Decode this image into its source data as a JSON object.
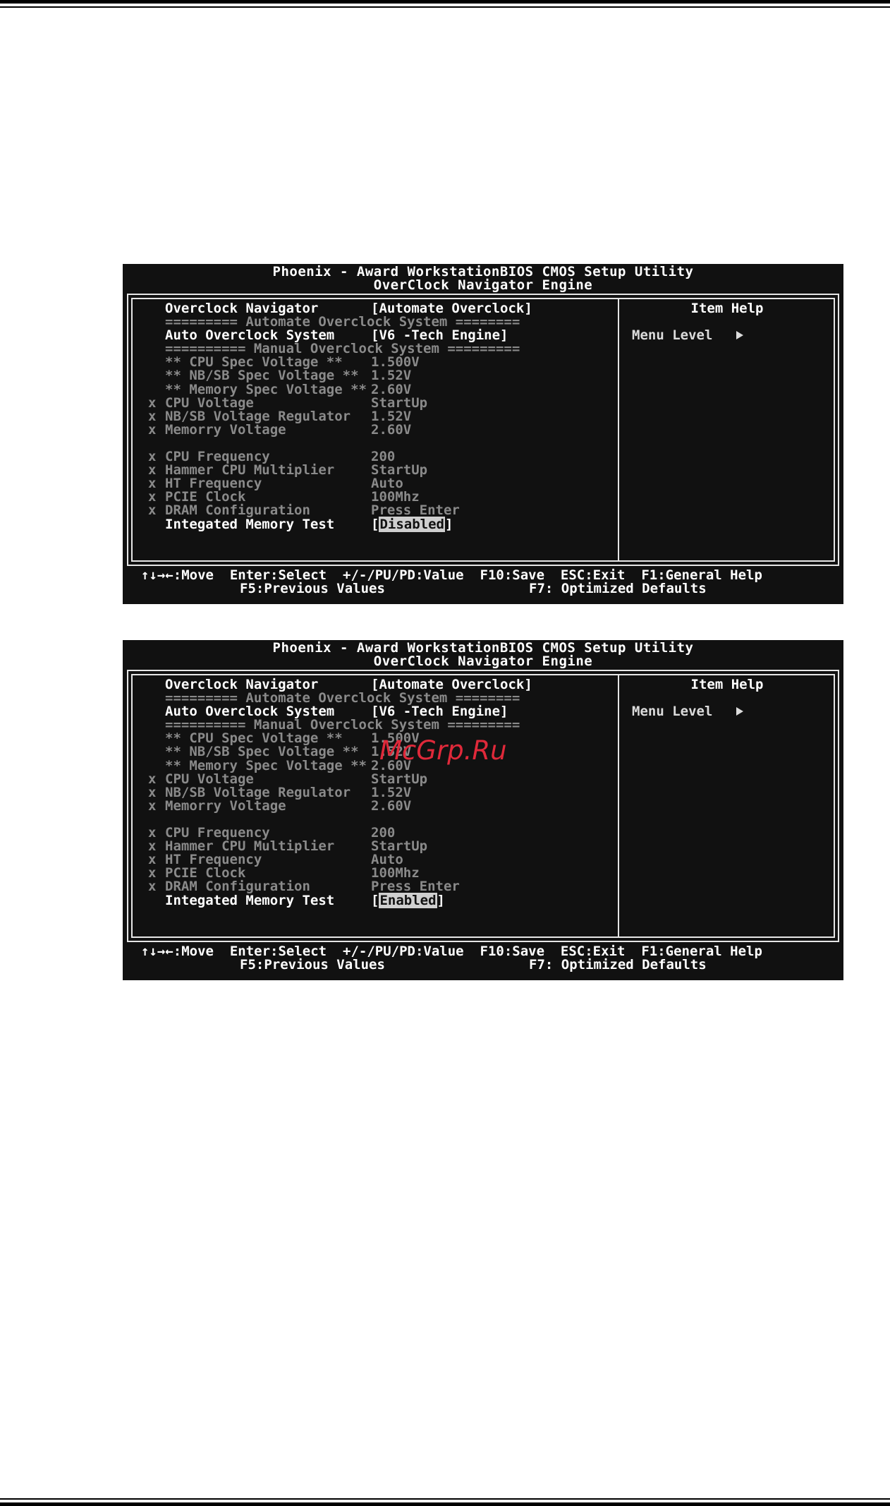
{
  "screens": [
    {
      "header": {
        "line1": "Phoenix - Award WorkstationBIOS CMOS Setup Utility",
        "line2": "OverClock Navigator Engine"
      },
      "rows": [
        {
          "mark": "",
          "label": "Overclock Navigator",
          "value": "[Automate Overclock]",
          "state": "active"
        },
        {
          "mark": "",
          "label": "========= Automate Overclock System ========",
          "value": "",
          "state": "separator"
        },
        {
          "mark": "",
          "label": "Auto Overclock System",
          "value": "[V6 -Tech Engine]",
          "state": "active"
        },
        {
          "mark": "",
          "label": "========== Manual Overclock System =========",
          "value": "",
          "state": "separator"
        },
        {
          "mark": "",
          "label": "** CPU Spec Voltage **",
          "value": "1.500V",
          "state": "disabled"
        },
        {
          "mark": "",
          "label": "** NB/SB Spec Voltage **",
          "value": "1.52V",
          "state": "disabled"
        },
        {
          "mark": "",
          "label": "** Memory Spec Voltage **",
          "value": "2.60V",
          "state": "disabled"
        },
        {
          "mark": "x",
          "label": "CPU Voltage",
          "value": "StartUp",
          "state": "disabled"
        },
        {
          "mark": "x",
          "label": "NB/SB Voltage Regulator",
          "value": "1.52V",
          "state": "disabled"
        },
        {
          "mark": "x",
          "label": "Memorry Voltage",
          "value": "2.60V",
          "state": "disabled"
        },
        {
          "mark": "",
          "label": "",
          "value": "",
          "state": "blank"
        },
        {
          "mark": "x",
          "label": "CPU Frequency",
          "value": "200",
          "state": "disabled"
        },
        {
          "mark": "x",
          "label": "Hammer CPU Multiplier",
          "value": "StartUp",
          "state": "disabled"
        },
        {
          "mark": "x",
          "label": "HT Frequency",
          "value": "Auto",
          "state": "disabled"
        },
        {
          "mark": "x",
          "label": "PCIE Clock",
          "value": "100Mhz",
          "state": "disabled"
        },
        {
          "mark": "x",
          "label": "DRAM Configuration",
          "value": "Press Enter",
          "state": "disabled"
        },
        {
          "mark": "",
          "label": "Integated Memory Test",
          "value": "[Disabled]",
          "state": "selected"
        }
      ],
      "help": {
        "title": "Item Help",
        "menu_level": "Menu Level"
      },
      "footer": {
        "move": "↑↓→←:Move",
        "select": "Enter:Select",
        "value": "+/-/PU/PD:Value",
        "save": "F10:Save",
        "exit": "ESC:Exit",
        "help": "F1:General Help",
        "previous": "F5:Previous Values",
        "defaults": "F7: Optimized Defaults"
      }
    },
    {
      "header": {
        "line1": "Phoenix - Award WorkstationBIOS CMOS Setup Utility",
        "line2": "OverClock Navigator Engine"
      },
      "rows": [
        {
          "mark": "",
          "label": "Overclock Navigator",
          "value": "[Automate Overclock]",
          "state": "active"
        },
        {
          "mark": "",
          "label": "========= Automate Overclock System ========",
          "value": "",
          "state": "separator"
        },
        {
          "mark": "",
          "label": "Auto Overclock System",
          "value": "[V6 -Tech Engine]",
          "state": "active"
        },
        {
          "mark": "",
          "label": "========== Manual Overclock System =========",
          "value": "",
          "state": "separator"
        },
        {
          "mark": "",
          "label": "** CPU Spec Voltage **",
          "value": "1.500V",
          "state": "disabled"
        },
        {
          "mark": "",
          "label": "** NB/SB Spec Voltage **",
          "value": "1.52V",
          "state": "disabled"
        },
        {
          "mark": "",
          "label": "** Memory Spec Voltage **",
          "value": "2.60V",
          "state": "disabled"
        },
        {
          "mark": "x",
          "label": "CPU Voltage",
          "value": "StartUp",
          "state": "disabled"
        },
        {
          "mark": "x",
          "label": "NB/SB Voltage Regulator",
          "value": "1.52V",
          "state": "disabled"
        },
        {
          "mark": "x",
          "label": "Memorry Voltage",
          "value": "2.60V",
          "state": "disabled"
        },
        {
          "mark": "",
          "label": "",
          "value": "",
          "state": "blank"
        },
        {
          "mark": "x",
          "label": "CPU Frequency",
          "value": "200",
          "state": "disabled"
        },
        {
          "mark": "x",
          "label": "Hammer CPU Multiplier",
          "value": "StartUp",
          "state": "disabled"
        },
        {
          "mark": "x",
          "label": "HT Frequency",
          "value": "Auto",
          "state": "disabled"
        },
        {
          "mark": "x",
          "label": "PCIE Clock",
          "value": "100Mhz",
          "state": "disabled"
        },
        {
          "mark": "x",
          "label": "DRAM Configuration",
          "value": "Press Enter",
          "state": "disabled"
        },
        {
          "mark": "",
          "label": "Integated Memory Test",
          "value": "[Enabled]",
          "state": "selected"
        }
      ],
      "help": {
        "title": "Item Help",
        "menu_level": "Menu Level"
      },
      "footer": {
        "move": "↑↓→←:Move",
        "select": "Enter:Select",
        "value": "+/-/PU/PD:Value",
        "save": "F10:Save",
        "exit": "ESC:Exit",
        "help": "F1:General Help",
        "previous": "F5:Previous Values",
        "defaults": "F7: Optimized Defaults"
      }
    }
  ],
  "watermark": "McGrp.Ru"
}
